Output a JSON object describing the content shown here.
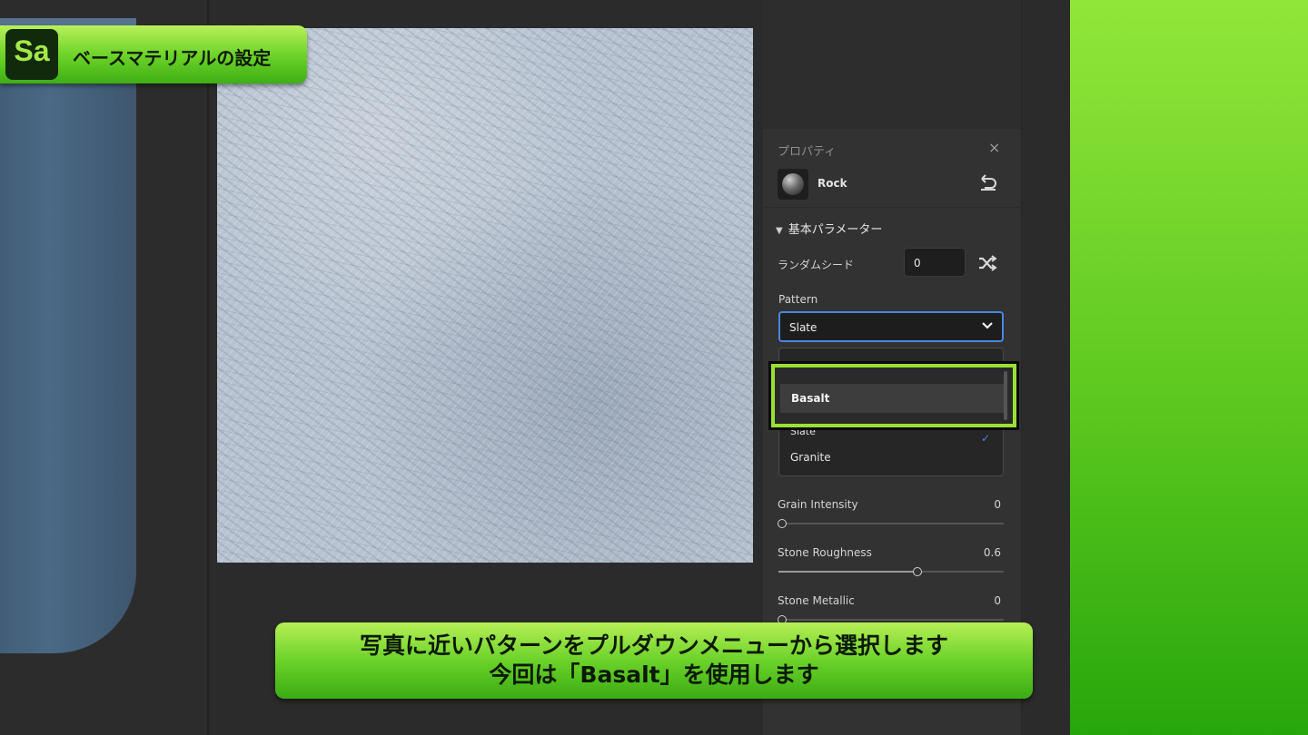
{
  "banner": {
    "logo": "Sa",
    "title": "ベースマテリアルの設定"
  },
  "panel": {
    "title": "プロパティ",
    "close_icon": "×",
    "material_name": "Rock",
    "section_title": "基本パラメーター",
    "random_seed": {
      "label": "ランダムシード",
      "value": "0"
    },
    "pattern": {
      "label": "Pattern",
      "selected": "Slate",
      "options": [
        "Basalt",
        "Slate",
        "Granite"
      ],
      "highlighted": "Basalt"
    },
    "sliders": [
      {
        "label": "Grain Intensity",
        "value": "0",
        "fraction": 0.0
      },
      {
        "label": "Stone Roughness",
        "value": "0.6",
        "fraction": 0.6
      },
      {
        "label": "Stone Metallic",
        "value": "0",
        "fraction": 0.0
      }
    ]
  },
  "caption": {
    "line1": "写真に近いパターンをプルダウンメニューから選択します",
    "line2": "今回は「Basalt」を使用します"
  },
  "colors": {
    "accent": "#4a86e0",
    "highlight_green": "#9ae034"
  }
}
